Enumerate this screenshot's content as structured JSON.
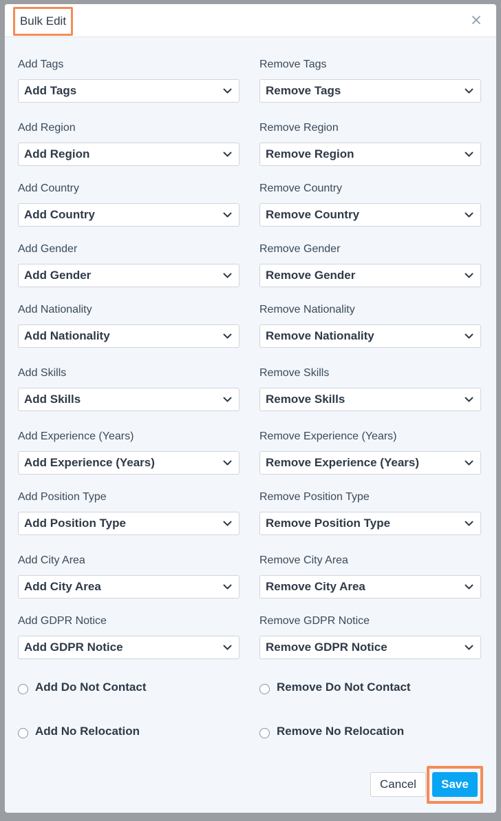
{
  "modal": {
    "title": "Bulk Edit",
    "close_icon": "close-icon"
  },
  "fields": {
    "add_tags": {
      "label": "Add Tags",
      "value": "Add Tags"
    },
    "remove_tags": {
      "label": "Remove Tags",
      "value": "Remove Tags"
    },
    "add_region": {
      "label": "Add Region",
      "value": "Add Region"
    },
    "remove_region": {
      "label": "Remove Region",
      "value": "Remove Region"
    },
    "add_country": {
      "label": "Add Country",
      "value": "Add Country"
    },
    "remove_country": {
      "label": "Remove Country",
      "value": "Remove Country"
    },
    "add_gender": {
      "label": "Add Gender",
      "value": "Add Gender"
    },
    "remove_gender": {
      "label": "Remove Gender",
      "value": "Remove Gender"
    },
    "add_nationality": {
      "label": "Add Nationality",
      "value": "Add Nationality"
    },
    "remove_nationality": {
      "label": "Remove Nationality",
      "value": "Remove Nationality"
    },
    "add_skills": {
      "label": "Add Skills",
      "value": "Add Skills"
    },
    "remove_skills": {
      "label": "Remove Skills",
      "value": "Remove Skills"
    },
    "add_experience": {
      "label": "Add Experience (Years)",
      "value": "Add Experience (Years)"
    },
    "remove_experience": {
      "label": "Remove Experience (Years)",
      "value": "Remove Experience (Years)"
    },
    "add_position_type": {
      "label": "Add Position Type",
      "value": "Add Position Type"
    },
    "remove_position_type": {
      "label": "Remove Position Type",
      "value": "Remove Position Type"
    },
    "add_city_area": {
      "label": "Add City Area",
      "value": "Add City Area"
    },
    "remove_city_area": {
      "label": "Remove City Area",
      "value": "Remove City Area"
    },
    "add_gdpr": {
      "label": "Add GDPR Notice",
      "value": "Add GDPR Notice"
    },
    "remove_gdpr": {
      "label": "Remove GDPR Notice",
      "value": "Remove GDPR Notice"
    }
  },
  "options": {
    "add_do_not_contact": {
      "label": "Add Do Not Contact",
      "checked": false
    },
    "remove_do_not_contact": {
      "label": "Remove Do Not Contact",
      "checked": false
    },
    "add_no_relocation": {
      "label": "Add No Relocation",
      "checked": false
    },
    "remove_no_relocation": {
      "label": "Remove No Relocation",
      "checked": false
    }
  },
  "footer": {
    "cancel_label": "Cancel",
    "save_label": "Save"
  },
  "colors": {
    "primary": "#0aa5f2",
    "highlight": "#f48c57",
    "modal_bg": "#f3f6fa"
  }
}
